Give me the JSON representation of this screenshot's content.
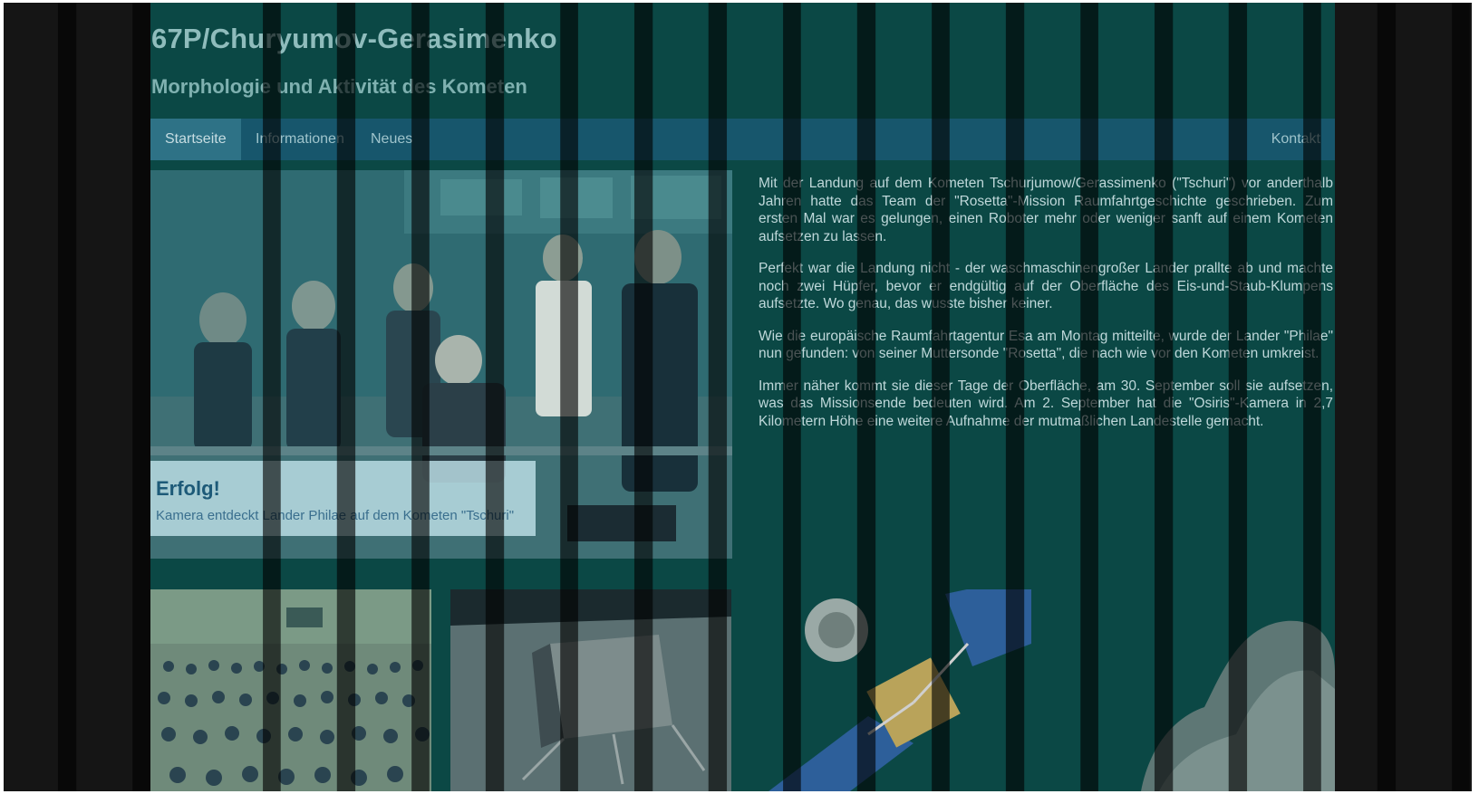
{
  "header": {
    "title": "67P/Churyumov-Gerasimenko",
    "subtitle": "Morphologie und Aktivität des Kometen"
  },
  "nav": {
    "items": [
      {
        "label": "Startseite",
        "active": true
      },
      {
        "label": "Informationen",
        "active": false
      },
      {
        "label": "Neues",
        "active": false
      }
    ],
    "contact": "Kontakt"
  },
  "hero": {
    "caption_title": "Erfolg!",
    "caption_text": "Kamera entdeckt Lander Philae auf dem Kometen \"Tschuri\""
  },
  "article": {
    "paragraphs": [
      "Mit der Landung auf dem Kometen Tschurjumow/Gerassimenko (\"Tschuri\") vor anderthalb Jahren hatte das Team der \"Rosetta\"-Mission Raumfahrtgeschichte geschrieben. Zum ersten Mal war es gelungen, einen Roboter mehr oder weniger sanft auf einem Kometen aufsetzen zu lassen.",
      "Perfekt war die Landung nicht - der waschmaschinengroßer Lander prallte ab und machte noch zwei Hüpfer, bevor er endgültig auf der Oberfläche des Eis-und-Staub-Klumpens aufsetzte. Wo genau, das wusste bisher keiner.",
      "Wie die europäische Raumfahrtagentur Esa am Montag mitteilte, wurde der Lander \"Philae\" nun gefunden: von seiner Muttersonde \"Rosetta\", die nach wie vor den Kometen umkreist.",
      "Immer näher kommt sie dieser Tage der Oberfläche, am 30. September soll sie aufsetzen, was das Missionsende bedeuten wird. Am 2. September hat die \"Osiris\"-Kamera in 2,7 Kilometern Höhe eine weitere Aufnahme der mutmaßlichen Landestelle gemacht."
    ]
  },
  "colors": {
    "wrapper_bg": "#0b4845",
    "nav_bg": "#17566c",
    "nav_active_bg": "#2e7286",
    "title": "#8fbcbc",
    "caption_title": "#1d5a78"
  }
}
